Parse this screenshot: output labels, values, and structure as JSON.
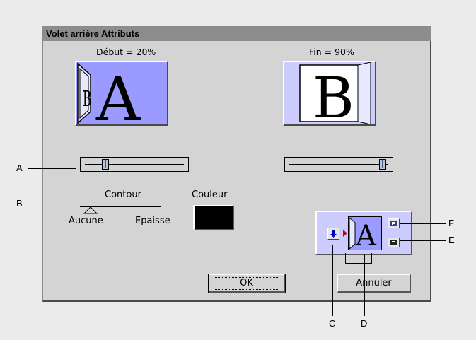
{
  "dialog": {
    "title": "Volet arrière  Attributs",
    "start_label": "Début = 20%",
    "end_label": "Fin = 90%",
    "start_letter": "A",
    "end_letter": "B",
    "outline": {
      "title": "Contour",
      "min_label": "Aucune",
      "max_label": "Epaisse"
    },
    "color": {
      "title": "Couleur",
      "value": "#000000"
    },
    "ok_label": "OK",
    "cancel_label": "Annuler"
  },
  "callouts": {
    "a": "A",
    "b": "B",
    "c": "C",
    "d": "D",
    "e": "E",
    "f": "F"
  },
  "icons": {
    "side_direction": "arrow-down-icon",
    "forward": "forward-direction-icon",
    "reverse": "reverse-direction-icon"
  },
  "colors": {
    "preview_start_bg": "#9a9aff",
    "preview_end_bg": "#ccccff",
    "panel_bg": "#d4d4d4",
    "title_bar": "#8d8d8d"
  },
  "sliders": {
    "start_percent": 20,
    "end_percent": 90
  }
}
